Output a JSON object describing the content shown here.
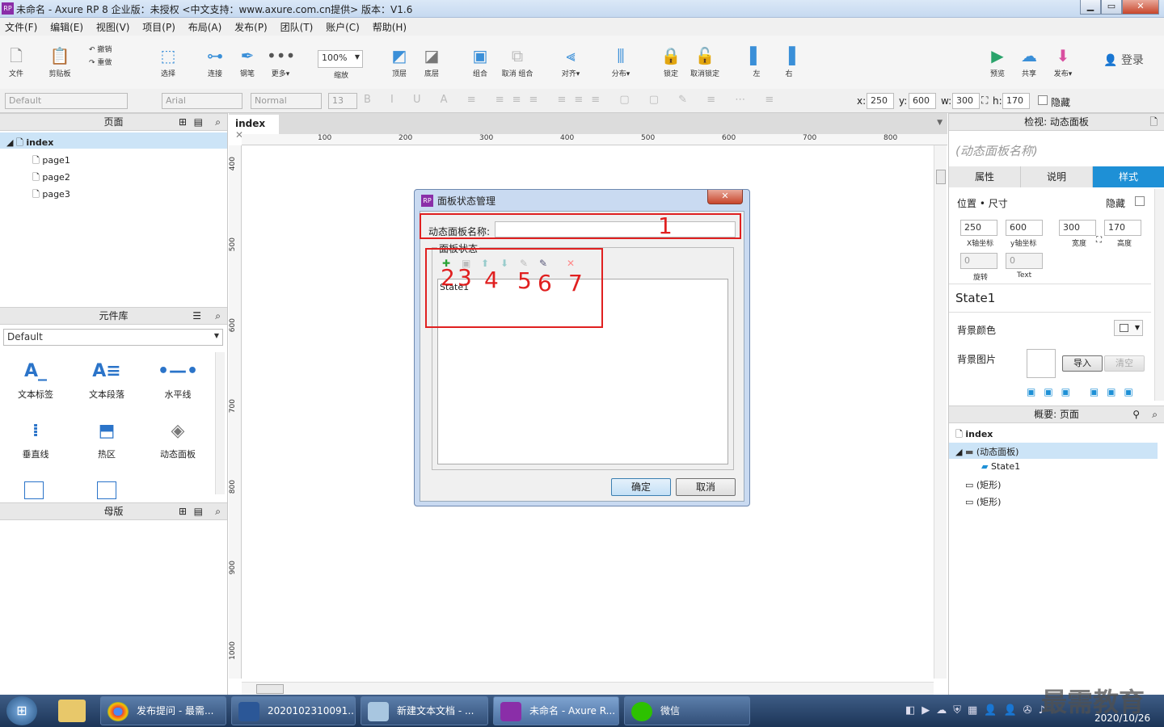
{
  "window": {
    "title": "未命名 - Axure RP 8 企业版：未授权      <中文支持：www.axure.com.cn提供> 版本：V1.6"
  },
  "menu": [
    "文件(F)",
    "编辑(E)",
    "视图(V)",
    "项目(P)",
    "布局(A)",
    "发布(P)",
    "团队(T)",
    "账户(C)",
    "帮助(H)"
  ],
  "toolbar": {
    "file": "文件",
    "clipboard": "剪贴板",
    "undo": "撤销",
    "redo": "重做",
    "select": "选择",
    "connect": "连接",
    "pen": "钢笔",
    "more": "更多▾",
    "zoom": "100%",
    "zoom_label": "缩放",
    "top": "顶层",
    "bottom": "底层",
    "group": "组合",
    "ungroup": "取消 组合",
    "align": "对齐▾",
    "distribute": "分布▾",
    "lock": "锁定",
    "unlock": "取消锁定",
    "left": "左",
    "right": "右",
    "preview": "预览",
    "share": "共享",
    "publish": "发布▾",
    "login": "登录"
  },
  "formatbar": {
    "style": "Default",
    "font": "Arial",
    "weight": "Normal",
    "size": "13",
    "x_label": "x:",
    "x": "250",
    "y_label": "y:",
    "y": "600",
    "w_label": "w:",
    "w": "300",
    "h_label": "h:",
    "h": "170",
    "hidden": "隐藏"
  },
  "pages": {
    "title": "页面",
    "items": [
      {
        "label": "index",
        "level": 0
      },
      {
        "label": "page1",
        "level": 1
      },
      {
        "label": "page2",
        "level": 1
      },
      {
        "label": "page3",
        "level": 1
      }
    ]
  },
  "library": {
    "title": "元件库",
    "selected": "Default",
    "widgets": [
      "文本标签",
      "文本段落",
      "水平线",
      "垂直线",
      "热区",
      "动态面板"
    ]
  },
  "masters": {
    "title": "母版"
  },
  "canvas": {
    "tab": "index",
    "ruler_h": [
      "100",
      "200",
      "300",
      "400",
      "500",
      "600",
      "700",
      "800"
    ],
    "ruler_v": [
      "400",
      "500",
      "600",
      "700",
      "800",
      "900",
      "1000"
    ]
  },
  "dialog": {
    "title": "面板状态管理",
    "name_label": "动态面板名称:",
    "name_value": "",
    "states_group": "面板状态",
    "states": [
      "State1"
    ],
    "ok": "确定",
    "cancel": "取消",
    "annotations": [
      "1",
      "2",
      "3",
      "4",
      "5",
      "6",
      "7"
    ]
  },
  "inspector": {
    "header": "检视: 动态面板",
    "name_placeholder": "(动态面板名称)",
    "tabs": [
      "属性",
      "说明",
      "样式"
    ],
    "active_tab": "样式",
    "pos_size": "位置 • 尺寸",
    "hidden": "隐藏",
    "x": "250",
    "y": "600",
    "w": "300",
    "h": "170",
    "x_label": "X轴坐标",
    "y_label": "y轴坐标",
    "w_label": "宽度",
    "h_label": "高度",
    "rotate": "0",
    "text_rotate": "0",
    "rotate_label": "旋转",
    "text_label": "Text",
    "state": "State1",
    "bg_color": "背景颜色",
    "bg_image": "背景图片",
    "import": "导入",
    "clear": "清空"
  },
  "outline": {
    "header": "概要: 页面",
    "items": [
      {
        "label": "index",
        "level": 0
      },
      {
        "label": "(动态面板)",
        "level": 1
      },
      {
        "label": "State1",
        "level": 2
      },
      {
        "label": "(矩形)",
        "level": 1
      },
      {
        "label": "(矩形)",
        "level": 1
      }
    ]
  },
  "taskbar": {
    "apps": [
      "发布提问 - 最需...",
      "2020102310091...",
      "新建文本文档 - ...",
      "未命名 - Axure R...",
      "微信"
    ],
    "watermark": "最需教育",
    "date": "2020/10/26"
  },
  "colors": {
    "accent": "#3a8fd8",
    "annotation": "#e02020",
    "selection": "#cce4f7"
  }
}
